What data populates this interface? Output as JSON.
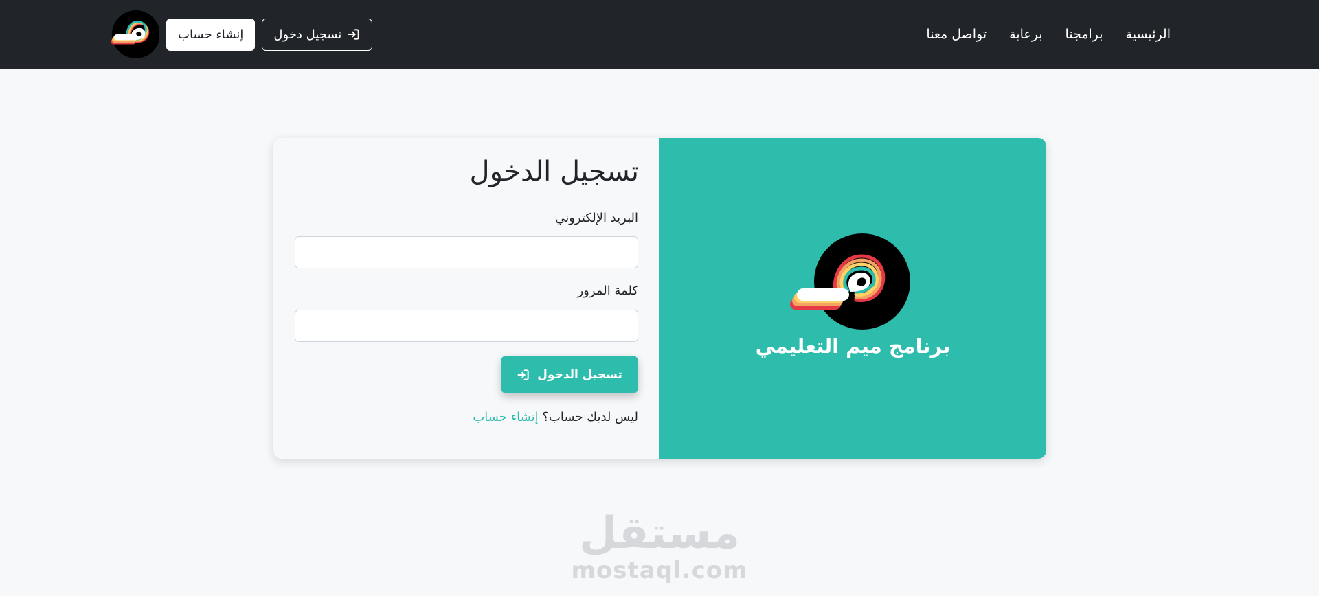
{
  "nav": {
    "links": [
      "الرئيسية",
      "برامجنا",
      "برعاية",
      "تواصل معنا"
    ],
    "login_label": "تسجيل دخول",
    "register_label": "إنشاء حساب"
  },
  "login_form": {
    "title": "تسجيل الدخول",
    "email_label": "البريد الإلكتروني",
    "email_value": "",
    "password_label": "كلمة المرور",
    "password_value": "",
    "submit_label": "تسجيل الدخول",
    "no_account_text": "ليس لديك حساب؟",
    "create_account_link": "إنشاء حساب"
  },
  "brand": {
    "name": "برنامج ميم التعليمي"
  },
  "watermark": {
    "arabic": "مستقل",
    "latin": "mostaql.com"
  },
  "colors": {
    "navbar": "#212529",
    "accent": "#2ebcad",
    "page_background": "#f7f8fa",
    "watermark": "#d6d8db"
  },
  "icons": {
    "login": "sign-in-icon",
    "logo": "meem-logo"
  }
}
